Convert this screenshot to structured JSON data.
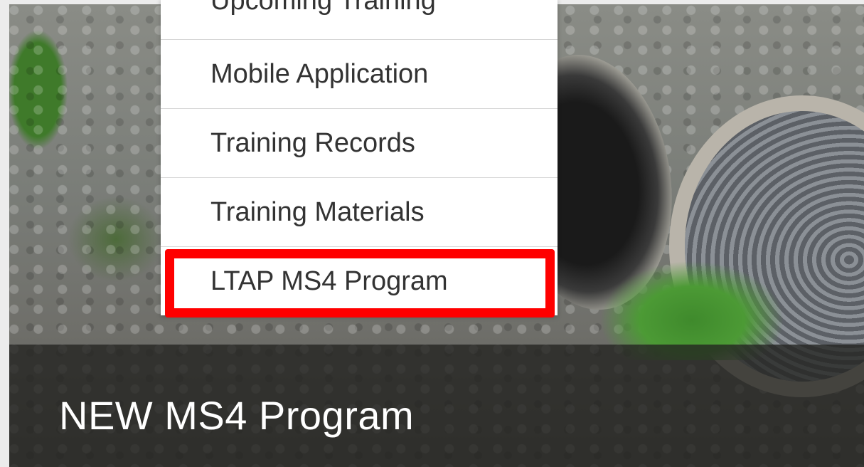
{
  "dropdown": {
    "items": [
      {
        "label": "Upcoming Training"
      },
      {
        "label": "Mobile Application"
      },
      {
        "label": "Training Records"
      },
      {
        "label": "Training Materials"
      },
      {
        "label": "LTAP MS4 Program"
      }
    ],
    "highlighted_index": 4,
    "highlight_color": "#ff0000"
  },
  "hero": {
    "title": "NEW MS4 Program"
  }
}
